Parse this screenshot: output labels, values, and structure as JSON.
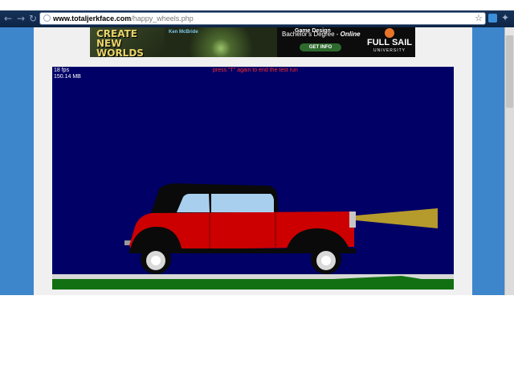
{
  "browser": {
    "nav": {
      "back_icon": "back-arrow-icon",
      "forward_icon": "forward-arrow-icon",
      "reload_icon": "reload-icon"
    },
    "address_bar": {
      "domain": "www.totaljerkface.com",
      "path": "/happy_wheels.php"
    },
    "icons": [
      "page-icon",
      "star-icon",
      "extension-icon",
      "wrench-icon"
    ]
  },
  "ad": {
    "headline": "CREATE NEW WORLDS",
    "byline": "Ken McBride",
    "degree_line1": "Game Design",
    "degree_line2_prefix": "Bachelor's Degree - ",
    "degree_line2_emphasis": "Online",
    "cta": "GET INFO",
    "brand": "FULL SAIL",
    "brand_sub": "UNIVERSITY"
  },
  "game": {
    "fps": "18 fps",
    "memory": "150.14 MB",
    "hint": "press \"T\" again to end the test run"
  },
  "colors": {
    "chrome": "#17335a",
    "page_side": "#3d86cc",
    "game_bg": "#000066",
    "car_body": "#cc0000",
    "car_roof": "#0a0a0a",
    "car_window": "#a8cfee",
    "ground": "#127012",
    "road": "#d8d8d8",
    "headlight_beam": "#b59a2c",
    "hint_text": "#ff2a2a"
  }
}
